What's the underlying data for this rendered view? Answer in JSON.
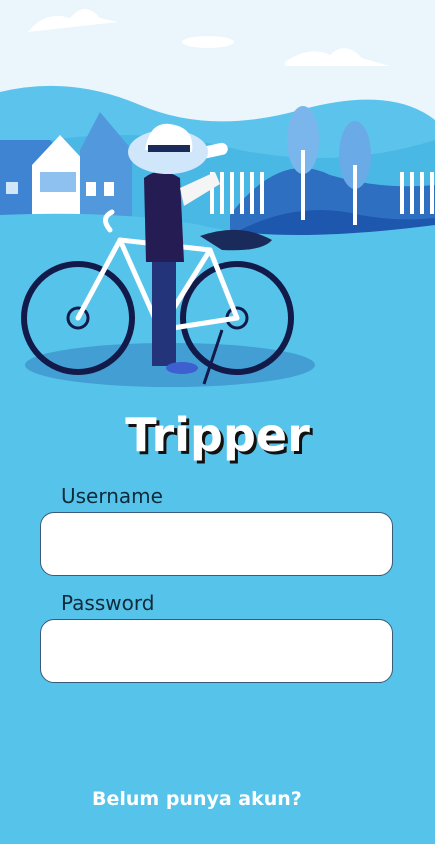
{
  "app": {
    "title": "Tripper"
  },
  "form": {
    "username_label": "Username",
    "username_value": "",
    "password_label": "Password",
    "password_value": ""
  },
  "footer": {
    "register_link": "Belum punya akun?"
  },
  "illustration": {
    "name": "cyclist-with-binoculars-illustration"
  },
  "colors": {
    "background": "#56c4ea",
    "title": "#ffffff",
    "link": "#ffffff"
  }
}
